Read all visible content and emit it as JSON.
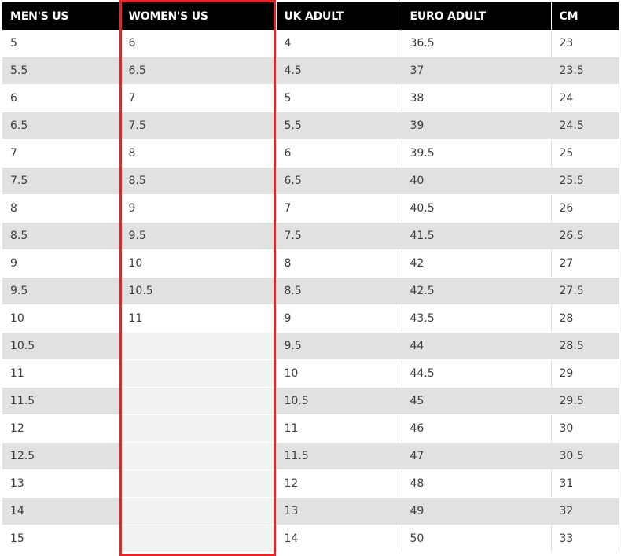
{
  "table": {
    "headers": [
      "MEN'S US",
      "WOMEN'S US",
      "UK ADULT",
      "EURO ADULT",
      "CM"
    ],
    "rows": [
      [
        "5",
        "6",
        "4",
        "36.5",
        "23"
      ],
      [
        "5.5",
        "6.5",
        "4.5",
        "37",
        "23.5"
      ],
      [
        "6",
        "7",
        "5",
        "38",
        "24"
      ],
      [
        "6.5",
        "7.5",
        "5.5",
        "39",
        "24.5"
      ],
      [
        "7",
        "8",
        "6",
        "39.5",
        "25"
      ],
      [
        "7.5",
        "8.5",
        "6.5",
        "40",
        "25.5"
      ],
      [
        "8",
        "9",
        "7",
        "40.5",
        "26"
      ],
      [
        "8.5",
        "9.5",
        "7.5",
        "41.5",
        "26.5"
      ],
      [
        "9",
        "10",
        "8",
        "42",
        "27"
      ],
      [
        "9.5",
        "10.5",
        "8.5",
        "42.5",
        "27.5"
      ],
      [
        "10",
        "11",
        "9",
        "43.5",
        "28"
      ],
      [
        "10.5",
        "",
        "9.5",
        "44",
        "28.5"
      ],
      [
        "11",
        "",
        "10",
        "44.5",
        "29"
      ],
      [
        "11.5",
        "",
        "10.5",
        "45",
        "29.5"
      ],
      [
        "12",
        "",
        "11",
        "46",
        "30"
      ],
      [
        "12.5",
        "",
        "11.5",
        "47",
        "30.5"
      ],
      [
        "13",
        "",
        "12",
        "48",
        "31"
      ],
      [
        "14",
        "",
        "13",
        "49",
        "32"
      ],
      [
        "15",
        "",
        "14",
        "50",
        "33"
      ]
    ]
  },
  "colors": {
    "header_bg": "#000000",
    "header_text": "#ffffff",
    "row_alt_bg": "#e1e1e1",
    "highlight_border": "#e8232a"
  }
}
